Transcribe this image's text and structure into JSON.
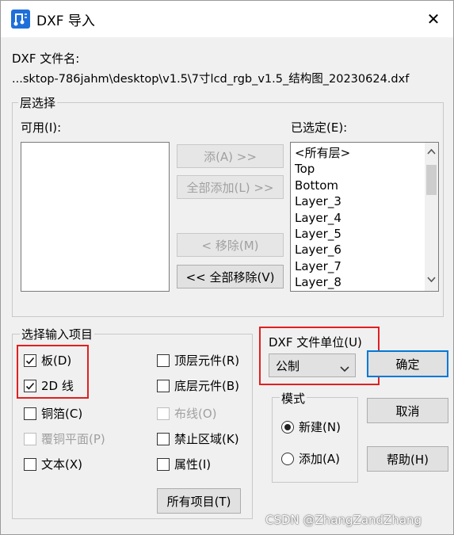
{
  "window": {
    "title": "DXF 导入",
    "close_glyph": "✕"
  },
  "file": {
    "label": "DXF 文件名:",
    "path": "...sktop-786jahm\\desktop\\v1.5\\7寸lcd_rgb_v1.5_结构图_20230624.dxf"
  },
  "layer_select": {
    "legend": "层选择",
    "available_label": "可用(I):",
    "selected_label": "已选定(E):",
    "add_button": "添(A) >>",
    "add_all_button": "全部添加(L) >>",
    "remove_button": "< 移除(M)",
    "remove_all_button": "<< 全部移除(V)",
    "selected_items": [
      "<所有层>",
      "Top",
      "Bottom",
      "Layer_3",
      "Layer_4",
      "Layer_5",
      "Layer_6",
      "Layer_7",
      "Layer_8"
    ]
  },
  "import_items": {
    "legend": "选择输入项目",
    "board": "板(D)",
    "line2d": "2D 线",
    "copper": "铜箔(C)",
    "copper_pour": "覆铜平面(P)",
    "text": "文本(X)",
    "top_components": "顶层元件(R)",
    "bottom_components": "底层元件(B)",
    "routing": "布线(O)",
    "keepout": "禁止区域(K)",
    "attributes": "属性(I)",
    "all_items_button": "所有项目(T)"
  },
  "units": {
    "label": "DXF 文件单位(U)",
    "value": "公制"
  },
  "mode": {
    "legend": "模式",
    "new": "新建(N)",
    "add": "添加(A)"
  },
  "buttons": {
    "ok": "确定",
    "cancel": "取消",
    "help": "帮助(H)"
  },
  "watermark": "CSDN @ZhangZandZhang",
  "colors": {
    "highlight": "#e02020",
    "default_button_border": "#0078d7"
  }
}
